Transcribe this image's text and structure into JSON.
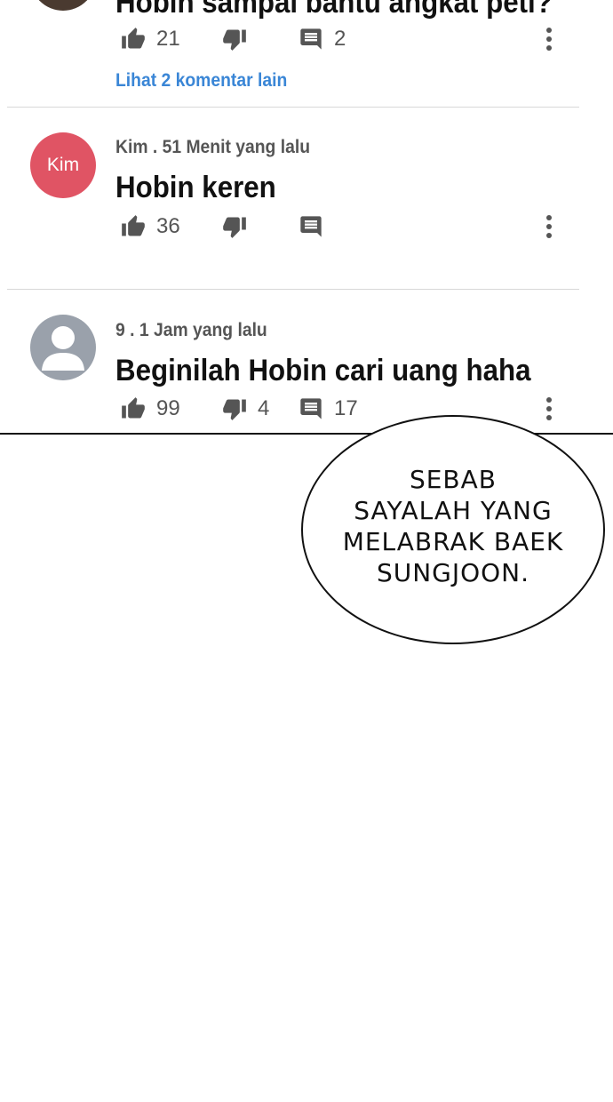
{
  "comments": [
    {
      "text": "Hobin sampai bantu angkat peti?",
      "likes": "21",
      "dislikes": "",
      "replies": "2",
      "view_more": "Lihat 2 komentar lain"
    },
    {
      "avatar_text": "Kim",
      "meta": "Kim . 51 Menit yang lalu",
      "text": "Hobin keren",
      "likes": "36",
      "dislikes": "",
      "replies": ""
    },
    {
      "meta": "9 . 1 Jam yang lalu",
      "text": "Beginilah Hobin cari uang haha",
      "likes": "99",
      "dislikes": "4",
      "replies": "17"
    }
  ],
  "speech_bubble": {
    "lines": [
      "SEBAB",
      "SAYALAH YANG",
      "MELABRAK BAEK",
      "SUNGJOON."
    ]
  },
  "colors": {
    "kim_avatar": "#e05464",
    "default_avatar": "#9aa1ab",
    "link": "#3a86d6"
  },
  "icons": {
    "like": "thumbs-up-icon",
    "dislike": "thumbs-down-icon",
    "reply": "comment-icon",
    "more": "more-vertical-icon"
  }
}
